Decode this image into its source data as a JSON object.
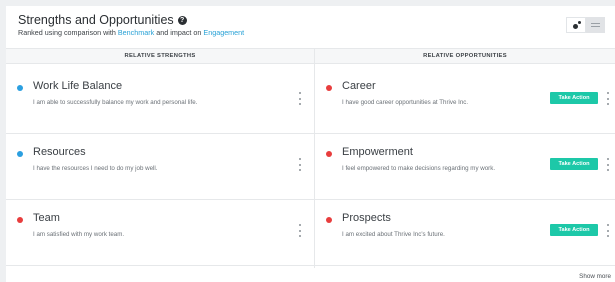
{
  "header": {
    "title": "Strengths and Opportunities",
    "help_icon": "?",
    "subtitle_prefix": "Ranked using comparison with ",
    "benchmark_link": "Benchmark",
    "subtitle_middle": " and impact on ",
    "engagement_link": "Engagement"
  },
  "columns": {
    "strengths": "RELATIVE STRENGTHS",
    "opportunities": "RELATIVE OPPORTUNITIES"
  },
  "strengths": [
    {
      "title": "Work Life Balance",
      "description": "I am able to successfully balance my work and personal life.",
      "color": "#2b9fe0"
    },
    {
      "title": "Resources",
      "description": "I have the resources I need to do my job well.",
      "color": "#2b9fe0"
    },
    {
      "title": "Team",
      "description": "I am satisfied with my work team.",
      "color": "#e83d3d"
    }
  ],
  "opportunities": [
    {
      "title": "Career",
      "description": "I have good career opportunities at Thrive Inc.",
      "color": "#e83d3d",
      "action": "Take Action"
    },
    {
      "title": "Empowerment",
      "description": "I feel empowered to make decisions regarding my work.",
      "color": "#e83d3d",
      "action": "Take Action"
    },
    {
      "title": "Prospects",
      "description": "I am excited about Thrive Inc's future.",
      "color": "#e83d3d",
      "action": "Take Action"
    }
  ],
  "footer": {
    "show_more": "Show more"
  },
  "colors": {
    "accent": "#1dc8a8",
    "link": "#27a1d6"
  }
}
